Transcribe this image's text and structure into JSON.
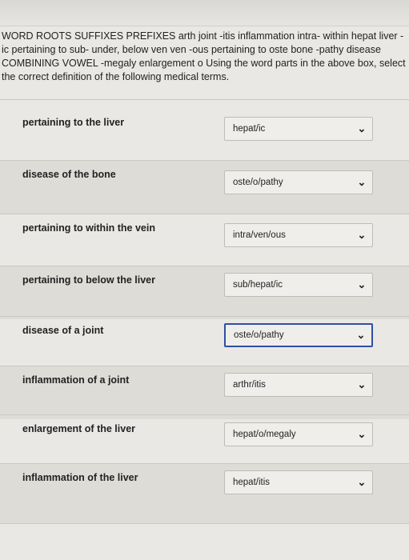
{
  "instructions": "WORD ROOTS SUFFIXES PREFIXES arth joint -itis inflammation intra- within hepat liver -ic pertaining to sub- under, below ven ven -ous pertaining to oste bone -pathy disease COMBINING VOWEL -megaly enlargement o Using the word parts in the above box, select the correct definition of the following medical terms.",
  "items": [
    {
      "term": "pertaining to the liver",
      "answer": "hepat/ic"
    },
    {
      "term": "disease of the bone",
      "answer": "oste/o/pathy"
    },
    {
      "term": "pertaining to within the vein",
      "answer": "intra/ven/ous"
    },
    {
      "term": "pertaining to below the liver",
      "answer": "sub/hepat/ic"
    },
    {
      "term": "disease of a joint",
      "answer": "oste/o/pathy"
    },
    {
      "term": "inflammation of a joint",
      "answer": "arthr/itis"
    },
    {
      "term": "enlargement of the liver",
      "answer": "hepat/o/megaly"
    },
    {
      "term": "inflammation of the liver",
      "answer": "hepat/itis"
    }
  ],
  "icons": {
    "dropdown": "chevron-down-icon"
  }
}
